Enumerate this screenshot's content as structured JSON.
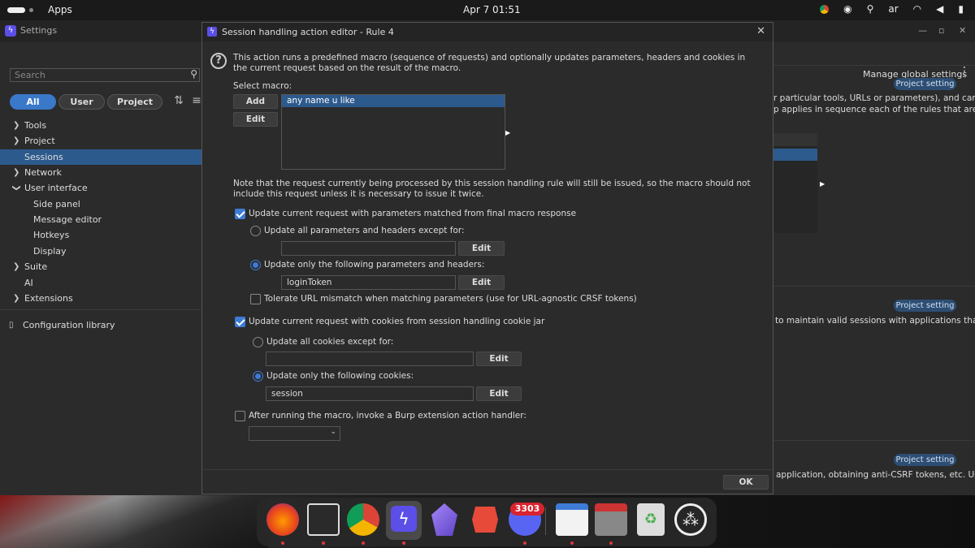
{
  "topbar": {
    "apps_label": "Apps",
    "clock": "Apr 7  01:51",
    "keyboard_layout": "ar",
    "tray_icons": [
      "chrome-icon",
      "discord-icon",
      "accessibility-icon",
      "wifi-icon",
      "volume-icon",
      "battery-icon"
    ]
  },
  "settings_window": {
    "title": "Settings",
    "minimize": "—",
    "maximize": "▫",
    "close": "✕",
    "search_placeholder": "Search",
    "scope_buttons": [
      "All",
      "User",
      "Project"
    ],
    "active_scope": "All",
    "tree": [
      {
        "label": "Tools",
        "expandable": true
      },
      {
        "label": "Project",
        "expandable": true
      },
      {
        "label": "Sessions",
        "expandable": false,
        "selected": true
      },
      {
        "label": "Network",
        "expandable": true
      },
      {
        "label": "User interface",
        "expandable": true,
        "expanded": true
      },
      {
        "label": "Side panel",
        "child": true
      },
      {
        "label": "Message editor",
        "child": true
      },
      {
        "label": "Hotkeys",
        "child": true
      },
      {
        "label": "Display",
        "child": true
      },
      {
        "label": "Suite",
        "expandable": true
      },
      {
        "label": "AI",
        "expandable": false
      },
      {
        "label": "Extensions",
        "expandable": true
      }
    ],
    "config_library": "Configuration library",
    "manage_global": "Manage global settings",
    "project_badge": "Project setting",
    "bg_text_1": "r particular tools, URLs or parameters), and can",
    "bg_text_2": "p applies in sequence each of the rules that are",
    "bg_text_3": "to maintain valid sessions with applications that",
    "bg_text_4": "application, obtaining anti-CSRF tokens, etc. Use"
  },
  "dialog": {
    "title": "Session handling action editor - Rule 4",
    "description": "This action runs a predefined macro (sequence of requests) and optionally updates parameters, headers and cookies in the current request based on the result of the macro.",
    "select_macro_label": "Select macro:",
    "add_button": "Add",
    "edit_button": "Edit",
    "macros": [
      "any name u like"
    ],
    "note": "Note that the request currently being processed by this session handling rule will still be issued, so the macro should not include this request unless it is necessary to issue it twice.",
    "update_params_cb": {
      "label": "Update current request with parameters matched from final macro response",
      "checked": true
    },
    "params_all_radio": {
      "label": "Update all parameters and headers except for:",
      "checked": false,
      "value": ""
    },
    "params_only_radio": {
      "label": "Update only the following parameters and headers:",
      "checked": true,
      "value": "loginToken"
    },
    "tolerate_cb": {
      "label": "Tolerate URL mismatch when matching parameters (use for URL-agnostic CRSF tokens)",
      "checked": false
    },
    "update_cookies_cb": {
      "label": "Update current request with cookies from session handling cookie jar",
      "checked": true
    },
    "cookies_all_radio": {
      "label": "Update all cookies except for:",
      "checked": false,
      "value": ""
    },
    "cookies_only_radio": {
      "label": "Update only the following cookies:",
      "checked": true,
      "value": "session"
    },
    "extension_cb": {
      "label": "After running the macro, invoke a Burp extension action handler:",
      "checked": false
    },
    "extension_select_value": "",
    "ok_button": "OK"
  },
  "dock": {
    "apps": [
      "firefox-icon",
      "terminal-icon",
      "chrome-icon",
      "burp-suite-icon",
      "obsidian-icon",
      "xmind-icon",
      "discord-icon",
      "text-editor-icon",
      "files-icon",
      "trash-icon",
      "show-apps-icon"
    ],
    "discord_badge": "3303"
  }
}
